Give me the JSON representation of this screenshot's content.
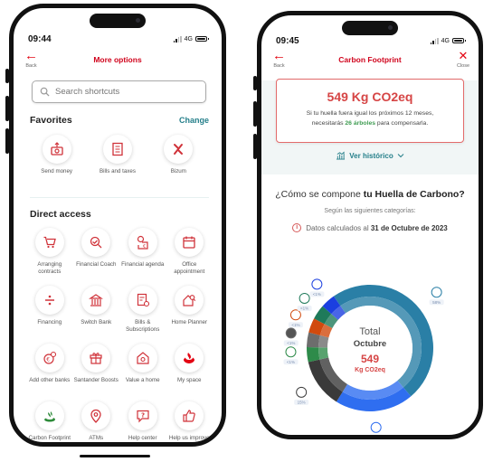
{
  "left_screen": {
    "status": {
      "time": "09:44",
      "network": "4G"
    },
    "nav": {
      "back_label": "Back",
      "title": "More options"
    },
    "search": {
      "placeholder": "Search shortcuts"
    },
    "favorites": {
      "title": "Favorites",
      "change_label": "Change",
      "items": [
        {
          "label": "Send money",
          "icon": "send-money-icon"
        },
        {
          "label": "Bills and taxes",
          "icon": "bill-icon"
        },
        {
          "label": "Bizum",
          "icon": "bizum-icon"
        }
      ]
    },
    "direct_access": {
      "title": "Direct access",
      "items": [
        {
          "label": "Arranging contracts",
          "icon": "cart-icon"
        },
        {
          "label": "Financial Coach",
          "icon": "coach-icon"
        },
        {
          "label": "Financial agenda",
          "icon": "agenda-icon"
        },
        {
          "label": "Office appointment",
          "icon": "calendar-icon"
        },
        {
          "label": "Financing",
          "icon": "divide-icon"
        },
        {
          "label": "Switch Bank",
          "icon": "bank-icon"
        },
        {
          "label": "Bills & Subscriptions",
          "icon": "subscriptions-icon"
        },
        {
          "label": "Home Planner",
          "icon": "home-planner-icon"
        },
        {
          "label": "Add other banks",
          "icon": "add-banks-icon"
        },
        {
          "label": "Santander Boosts",
          "icon": "gift-icon"
        },
        {
          "label": "Value a home",
          "icon": "value-home-icon"
        },
        {
          "label": "My space",
          "icon": "santander-flame-icon"
        },
        {
          "label": "Carbon Footprint",
          "icon": "carbon-leaf-icon"
        },
        {
          "label": "ATMs",
          "icon": "map-pin-icon"
        },
        {
          "label": "Help center",
          "icon": "help-icon"
        },
        {
          "label": "Help us improve",
          "icon": "thumbs-up-icon"
        }
      ]
    }
  },
  "right_screen": {
    "status": {
      "time": "09:45",
      "network": "4G"
    },
    "nav": {
      "back_label": "Back",
      "title": "Carbon Footprint",
      "close_label": "Close"
    },
    "summary": {
      "value": "549 Kg CO2eq",
      "line1": "Si tu huella fuera igual los próximos 12 meses,",
      "line2_pre": "necesitarás ",
      "trees": "26 árboles",
      "line2_post": " para compensarla."
    },
    "history_label": "Ver histórico",
    "question_pre": "¿Cómo se compone ",
    "question_bold": "tu Huella de Carbono?",
    "subtitle": "Según las siguientes categorías:",
    "calc_pre": "Datos calculados al ",
    "calc_date": "31 de Octubre de 2023",
    "donut_center": {
      "line1": "Total",
      "line2": "Octubre",
      "value": "549",
      "unit": "Kg CO2eq"
    }
  },
  "chart_data": {
    "type": "pie",
    "title": "Total Octubre 549 Kg CO2eq",
    "categories": [
      "Transport",
      "Home",
      "Shopping",
      "Food",
      "Other",
      "Savings",
      "Education",
      "Leisure"
    ],
    "values": [
      58,
      24,
      15,
      1,
      1,
      1,
      1,
      1
    ],
    "labels": [
      "58%",
      "24%",
      "15%",
      "<1%",
      "<1%",
      "<1%",
      "<1%",
      "<1%"
    ],
    "icons": [
      "bus-icon",
      "home-euro-icon",
      "shopping-bag-icon",
      "apple-icon",
      "more-icon",
      "savings-hand-icon",
      "graduation-cap-icon",
      "drink-icon"
    ],
    "colors": [
      "#2a7fa6",
      "#2f6ef0",
      "#3a3a3a",
      "#2e8b4a",
      "#6d6d6d",
      "#d14a0e",
      "#1f7a5a",
      "#1b3fe0"
    ]
  }
}
